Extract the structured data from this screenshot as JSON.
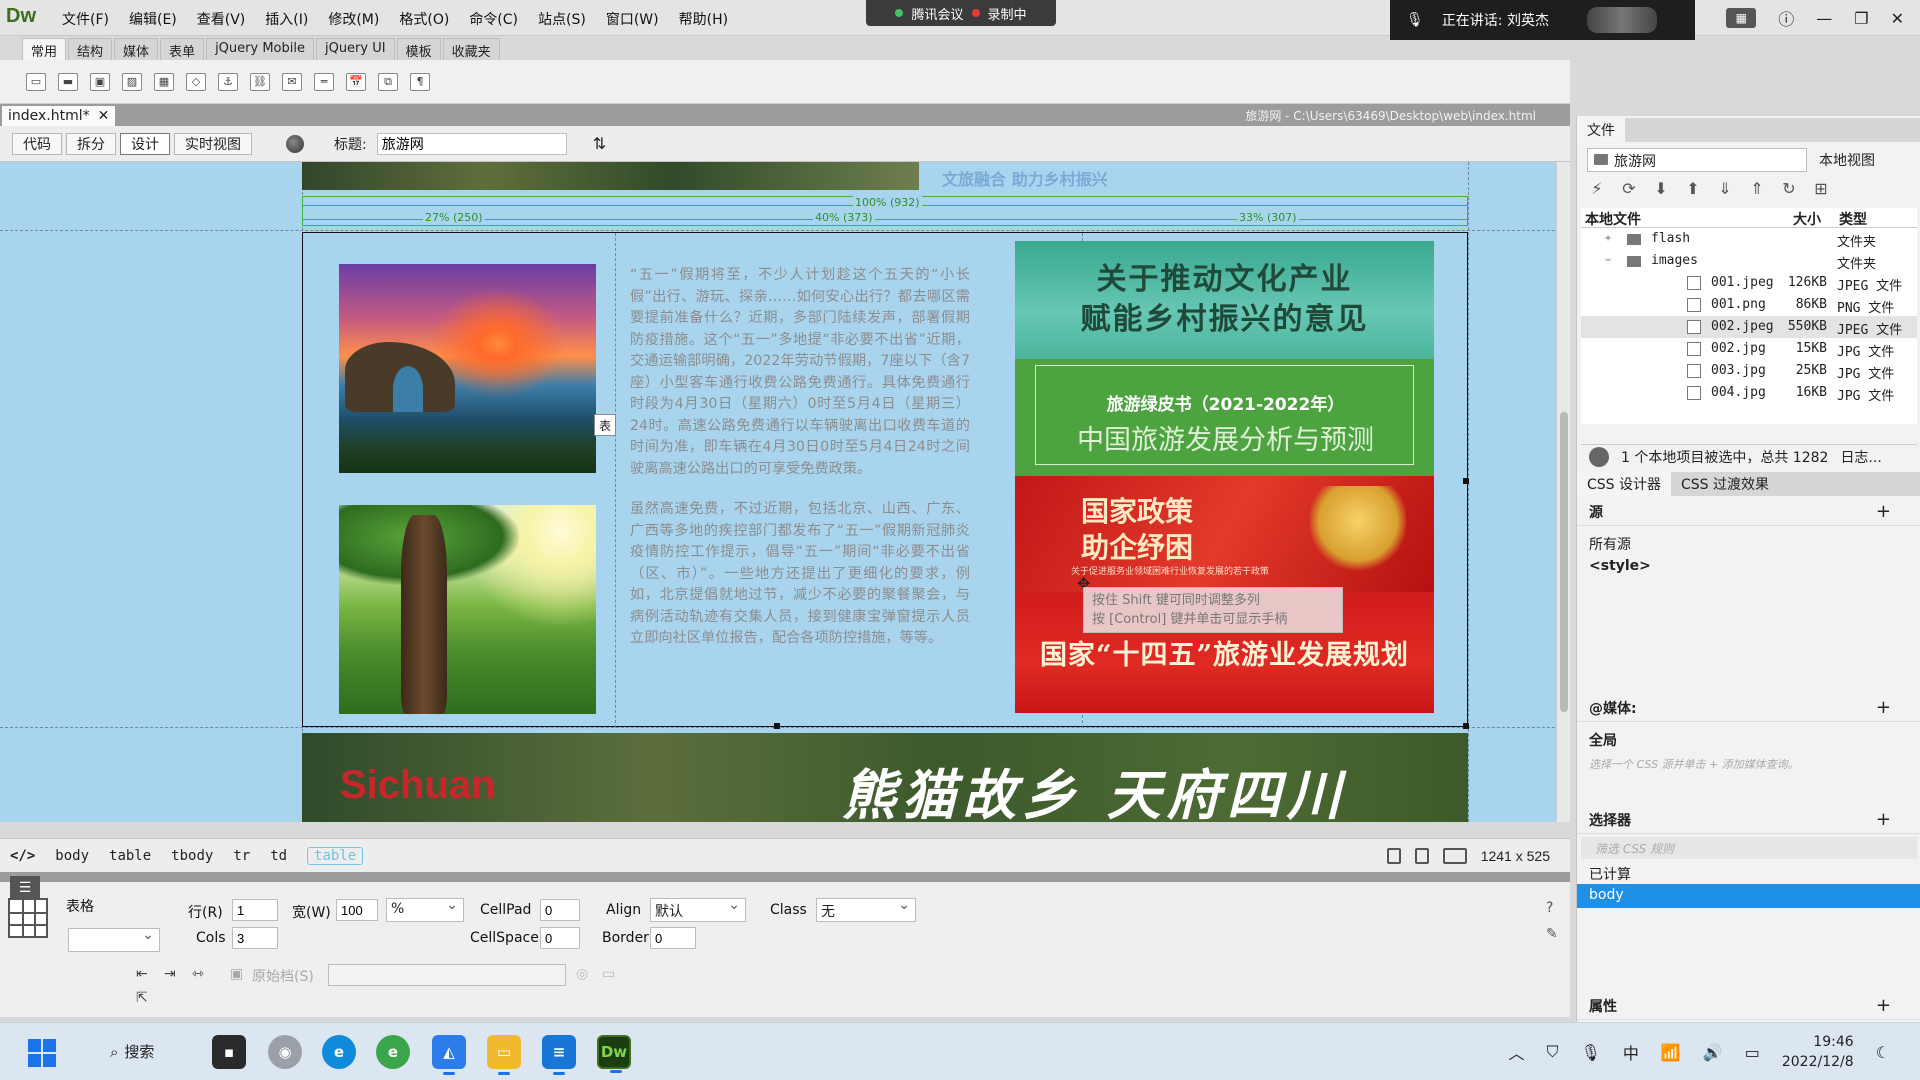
{
  "app": {
    "logo": "Dw",
    "menus": [
      "文件(F)",
      "编辑(E)",
      "查看(V)",
      "插入(I)",
      "修改(M)",
      "格式(O)",
      "命令(C)",
      "站点(S)",
      "窗口(W)",
      "帮助(H)"
    ],
    "meeting": {
      "name": "腾讯会议",
      "recording": "录制中"
    },
    "speaking": "正在讲话: 刘英杰"
  },
  "insert_tabs": [
    "常用",
    "结构",
    "媒体",
    "表单",
    "jQuery Mobile",
    "jQuery UI",
    "模板",
    "收藏夹"
  ],
  "document": {
    "tab": "index.html*",
    "path": "旅游网 - C:\\Users\\63469\\Desktop\\web\\index.html",
    "views": [
      "代码",
      "拆分",
      "设计",
      "实时视图"
    ],
    "title_label": "标题:",
    "title_value": "旅游网"
  },
  "canvas": {
    "top_banner_text": "文旅融合 助力乡村振兴",
    "width_total": "100% (932)",
    "width_col1": "27% (250)",
    "width_col2": "40% (373)",
    "width_col3": "33% (307)",
    "para1": "“五一”假期将至，不少人计划趁这个五天的“小长假”出行、游玩、探亲……如何安心出行？都去哪区需要提前准备什么？近期，多部门陆续发声，部署假期防疫措施。这个“五一”多地提“非必要不出省”近期，交通运输部明确，2022年劳动节假期，7座以下（含7座）小型客车通行收费公路免费通行。具体免费通行时段为4月30日（星期六）0时至5月4日（星期三）24时。高速公路免费通行以车辆驶离出口收费车道的时间为准，即车辆在4月30日0时至5月4日24时之间驶离高速公路出口的可享受免费政策。",
    "para2": "虽然高速免费，不过近期，包括北京、山西、广东、广西等多地的疾控部门都发布了“五一”假期新冠肺炎疫情防控工作提示，倡导“五一”期间“非必要不出省（区、市）”。一些地方还提出了更细化的要求，例如，北京提倡就地过节，减少不必要的聚餐聚会，与病例活动轨迹有交集人员，接到健康宝弹窗提示人员立即向社区单位报告，配合各项防控措施，等等。",
    "right_b1": [
      "关于推动文化产业",
      "赋能乡村振兴的意见"
    ],
    "right_b2_sub": "旅游绿皮书（2021-2022年）",
    "right_b2_main": "中国旅游发展分析与预测",
    "right_b3": [
      "国家政策",
      "助企纾困"
    ],
    "right_b3_small": "关于促进服务业领域困难行业恢复发展的若干政策",
    "right_b4": "国家“十四五”旅游业发展规划",
    "tooltip_line1": "按住 Shift 键可同时调整多列",
    "tooltip_line2": "按 [Control] 键并单击可显示手柄",
    "bottom_logo": "Sichuan",
    "bottom_slogan": "熊猫故乡 天府四川",
    "cell_marker": "表"
  },
  "tag_selector": {
    "tags": [
      "body",
      "table",
      "tbody",
      "tr",
      "td",
      "table"
    ],
    "size": "1241 x 525"
  },
  "properties": {
    "type": "表格",
    "rows_label": "行(R)",
    "rows": "1",
    "cols_label": "Cols",
    "cols": "3",
    "width_label": "宽(W)",
    "width": "100",
    "width_unit": "%",
    "cellpad_label": "CellPad",
    "cellpad": "0",
    "cellspace_label": "CellSpace",
    "cellspace": "0",
    "align_label": "Align",
    "align": "默认",
    "border_label": "Border",
    "border": "0",
    "class_label": "Class",
    "class": "无",
    "bgimage_label": "原始档(S)"
  },
  "files_panel": {
    "tab": "文件",
    "site": "旅游网",
    "view": "本地视图",
    "col_name": "本地文件",
    "col_size": "大小",
    "col_type": "类型",
    "items": [
      {
        "name": "flash",
        "size": "",
        "type": "文件夹",
        "kind": "folder",
        "toggle": "+",
        "indent": 0
      },
      {
        "name": "images",
        "size": "",
        "type": "文件夹",
        "kind": "folder",
        "toggle": "−",
        "indent": 0
      },
      {
        "name": "001.jpeg",
        "size": "126KB",
        "type": "JPEG 文件",
        "kind": "file",
        "toggle": "",
        "indent": 1
      },
      {
        "name": "001.png",
        "size": "86KB",
        "type": "PNG 文件",
        "kind": "file",
        "toggle": "",
        "indent": 1
      },
      {
        "name": "002.jpeg",
        "size": "550KB",
        "type": "JPEG 文件",
        "kind": "file",
        "toggle": "",
        "indent": 1,
        "selected": true
      },
      {
        "name": "002.jpg",
        "size": "15KB",
        "type": "JPG 文件",
        "kind": "file",
        "toggle": "",
        "indent": 1
      },
      {
        "name": "003.jpg",
        "size": "25KB",
        "type": "JPG 文件",
        "kind": "file",
        "toggle": "",
        "indent": 1
      },
      {
        "name": "004.jpg",
        "size": "16KB",
        "type": "JPG 文件",
        "kind": "file",
        "toggle": "",
        "indent": 1
      }
    ],
    "status": "1 个本地项目被选中，总共 1282",
    "log": "日志..."
  },
  "css_panel": {
    "tabs": [
      "CSS 设计器",
      "CSS 过渡效果"
    ],
    "sources_label": "源",
    "sources": [
      "所有源",
      "<style>"
    ],
    "media_label": "@媒体:",
    "media_global": "全局",
    "media_hint": "选择一个 CSS 源并单击 + 添加媒体查询。",
    "selectors_label": "选择器",
    "selectors_filter": "筛选 CSS 规则",
    "computed": "已计算",
    "selected": "body",
    "properties_label": "属性"
  },
  "taskbar": {
    "search": "搜索",
    "apps": [
      "task-view",
      "chrome",
      "edge",
      "ie",
      "tencent-meeting",
      "explorer",
      "notepad",
      "dreamweaver"
    ],
    "time": "19:46",
    "date": "2022/12/8",
    "ime": "中"
  },
  "colors": {
    "canvas_bg": "#a8d4ee",
    "guide_green": "#42b43c",
    "selected_blue": "#1e90e8",
    "dw_green": "#3c6e1e"
  }
}
